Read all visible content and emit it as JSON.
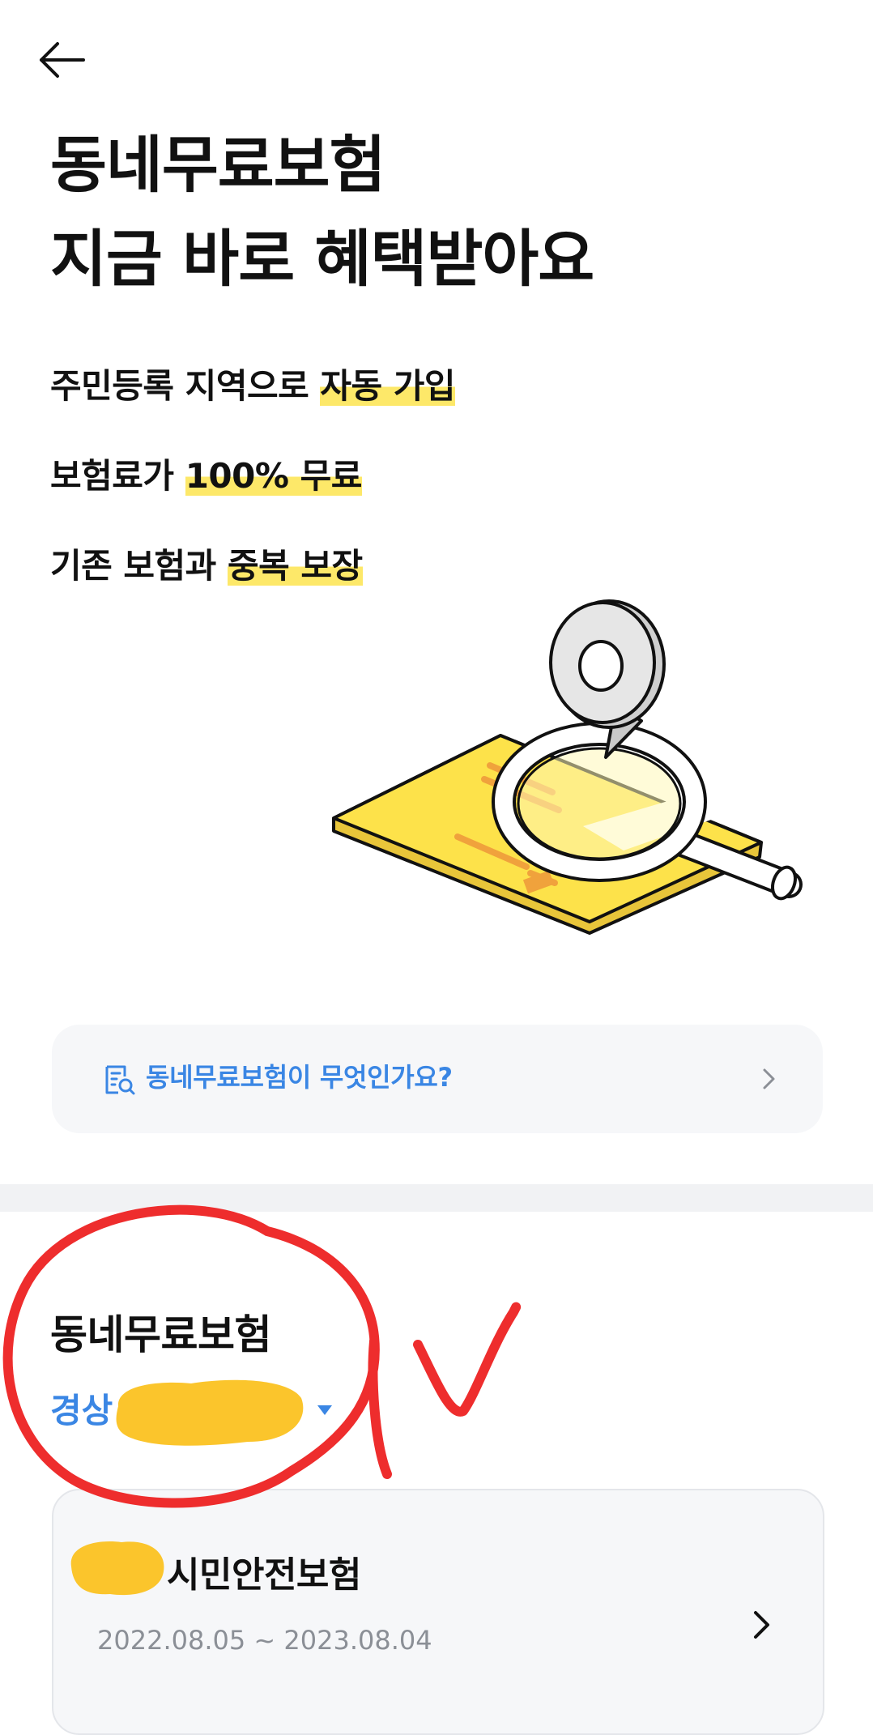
{
  "header": {
    "back_icon": "arrow-left-icon"
  },
  "hero": {
    "title_line1": "동네무료보험",
    "title_line2": "지금 바로 혜택받아요"
  },
  "benefits": [
    {
      "prefix": "주민등록 지역으로 ",
      "highlight": "자동 가입"
    },
    {
      "prefix": "보험료가 ",
      "highlight": "100% 무료"
    },
    {
      "prefix": "기존 보험과 ",
      "highlight": "중복 보장"
    }
  ],
  "info_link": {
    "label": "동네무료보험이 무엇인가요?",
    "icon": "document-search-icon",
    "chevron": "chevron-right-icon"
  },
  "section": {
    "title": "동네무료보험",
    "region_label": "경상",
    "region_caret": "caret-down-icon"
  },
  "policy": {
    "name": "시민안전보험",
    "period": "2022.08.05 ~ 2023.08.04",
    "chevron": "chevron-right-icon"
  },
  "colors": {
    "accent_blue": "#3a86e4",
    "highlight_yellow": "#fde869",
    "card_bg": "#f6f7f9",
    "annotation_red": "#ee2d2d",
    "redaction_yellow": "#fbc52c"
  }
}
